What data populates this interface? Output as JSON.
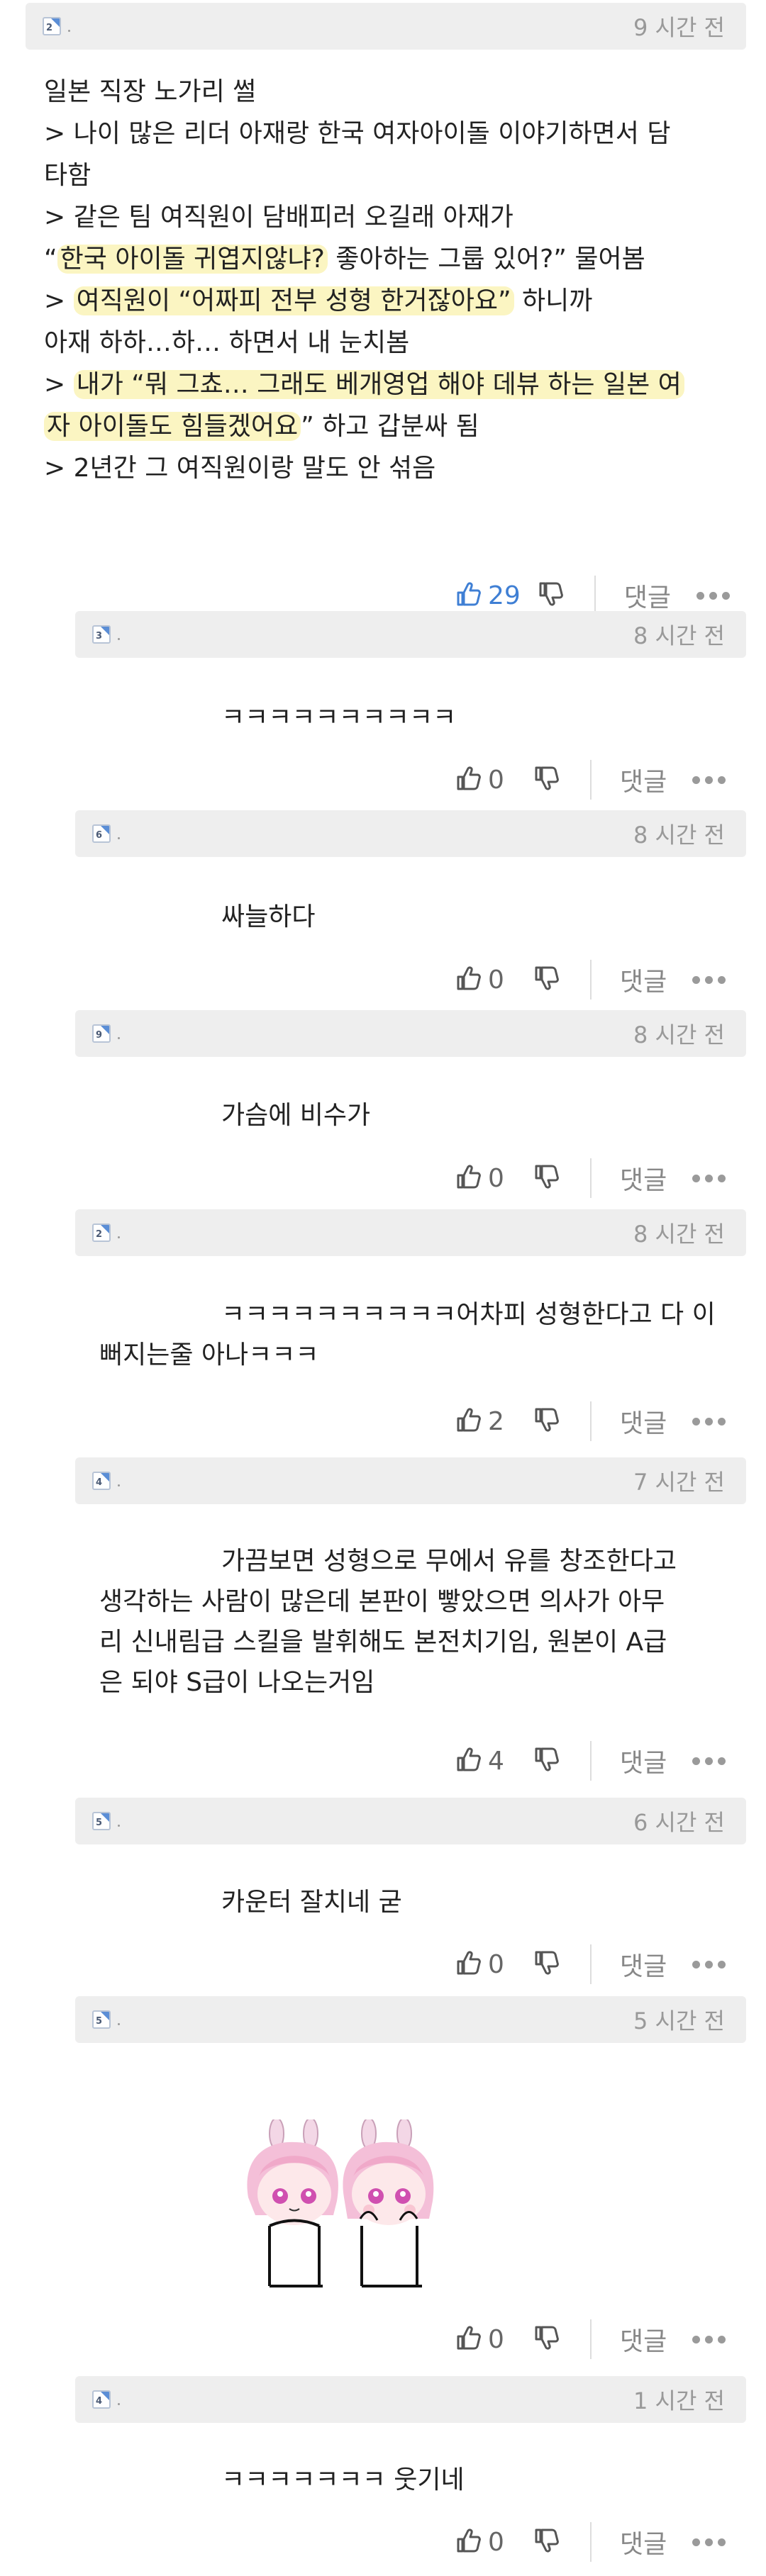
{
  "main_comment": {
    "badge": "2",
    "time": "9 시간 전",
    "lines": [
      [
        {
          "t": "일본 직장 노가리 썰"
        }
      ],
      [
        {
          "t": "> 나이 많은 리더 아재랑 한국 여자아이돌 이야기하면서 담"
        }
      ],
      [
        {
          "t": "타함"
        }
      ],
      [
        {
          "t": "> 같은 팀 여직원이 담배피러 오길래 아재가"
        }
      ],
      [
        {
          "t": "“"
        },
        {
          "t": "한국 아이돌 귀엽지않냐?",
          "hl": true
        },
        {
          "t": " 좋아하는 그룹 있어?” 물어봄"
        }
      ],
      [
        {
          "t": "> "
        },
        {
          "t": "여직원이 “어짜피 전부 성형 한거잖아요”",
          "hl": true
        },
        {
          "t": " 하니까"
        }
      ],
      [
        {
          "t": "아재 하하…하… 하면서 내 눈치봄"
        }
      ],
      [
        {
          "t": "> "
        },
        {
          "t": "내가 “뭐 그쵸… 그래도 베개영업 해야 데뷰 하는 일본 여",
          "hl": true
        }
      ],
      [
        {
          "t": "자 아이돌도 힘들겠어요",
          "hl": true
        },
        {
          "t": "” 하고 갑분싸 됨"
        }
      ],
      [
        {
          "t": "> 2년간 그 여직원이랑 말도 안 섞음"
        }
      ]
    ],
    "likes": "29",
    "reply_label": "댓글"
  },
  "replies": [
    {
      "badge": "3",
      "time": "8 시간 전",
      "lines": [
        "ㅋㅋㅋㅋㅋㅋㅋㅋㅋㅋ"
      ],
      "likes": "0",
      "reply_label": "댓글"
    },
    {
      "badge": "6",
      "time": "8 시간 전",
      "lines": [
        "싸늘하다"
      ],
      "likes": "0",
      "reply_label": "댓글"
    },
    {
      "badge": "9",
      "time": "8 시간 전",
      "lines": [
        "가슴에 비수가"
      ],
      "likes": "0",
      "reply_label": "댓글"
    },
    {
      "badge": "2",
      "time": "8 시간 전",
      "lines": [
        "ㅋㅋㅋㅋㅋㅋㅋㅋㅋㅋ어차피 성형한다고 다 이",
        "뻐지는줄 아나ㅋㅋㅋ"
      ],
      "likes": "2",
      "reply_label": "댓글"
    },
    {
      "badge": "4",
      "time": "7 시간 전",
      "lines": [
        "가끔보면 성형으로 무에서 유를 창조한다고",
        "생각하는 사람이 많은데 본판이 빻았으면 의사가 아무",
        "리 신내림급 스킬을 발휘해도 본전치기임, 원본이 A급",
        "은 되야 S급이 나오는거임"
      ],
      "likes": "4",
      "reply_label": "댓글"
    },
    {
      "badge": "5",
      "time": "6 시간 전",
      "lines": [
        "카운터 잘치네 굳"
      ],
      "likes": "0",
      "reply_label": "댓글"
    },
    {
      "badge": "5",
      "time": "5 시간 전",
      "lines": [],
      "sticker": true,
      "likes": "0",
      "reply_label": "댓글"
    },
    {
      "badge": "4",
      "time": "1 시간 전",
      "lines": [
        "ㅋㅋㅋㅋㅋㅋㅋ 웃기네"
      ],
      "likes": "0",
      "reply_label": "댓글"
    }
  ],
  "colors": {
    "accent_blue": "#3f7fd4",
    "highlight": "#fbf5c2",
    "header_gray": "#eeeeee"
  },
  "icons": [
    "thumbs-up-icon",
    "thumbs-down-icon",
    "more-dots-icon",
    "level-badge-icon"
  ]
}
